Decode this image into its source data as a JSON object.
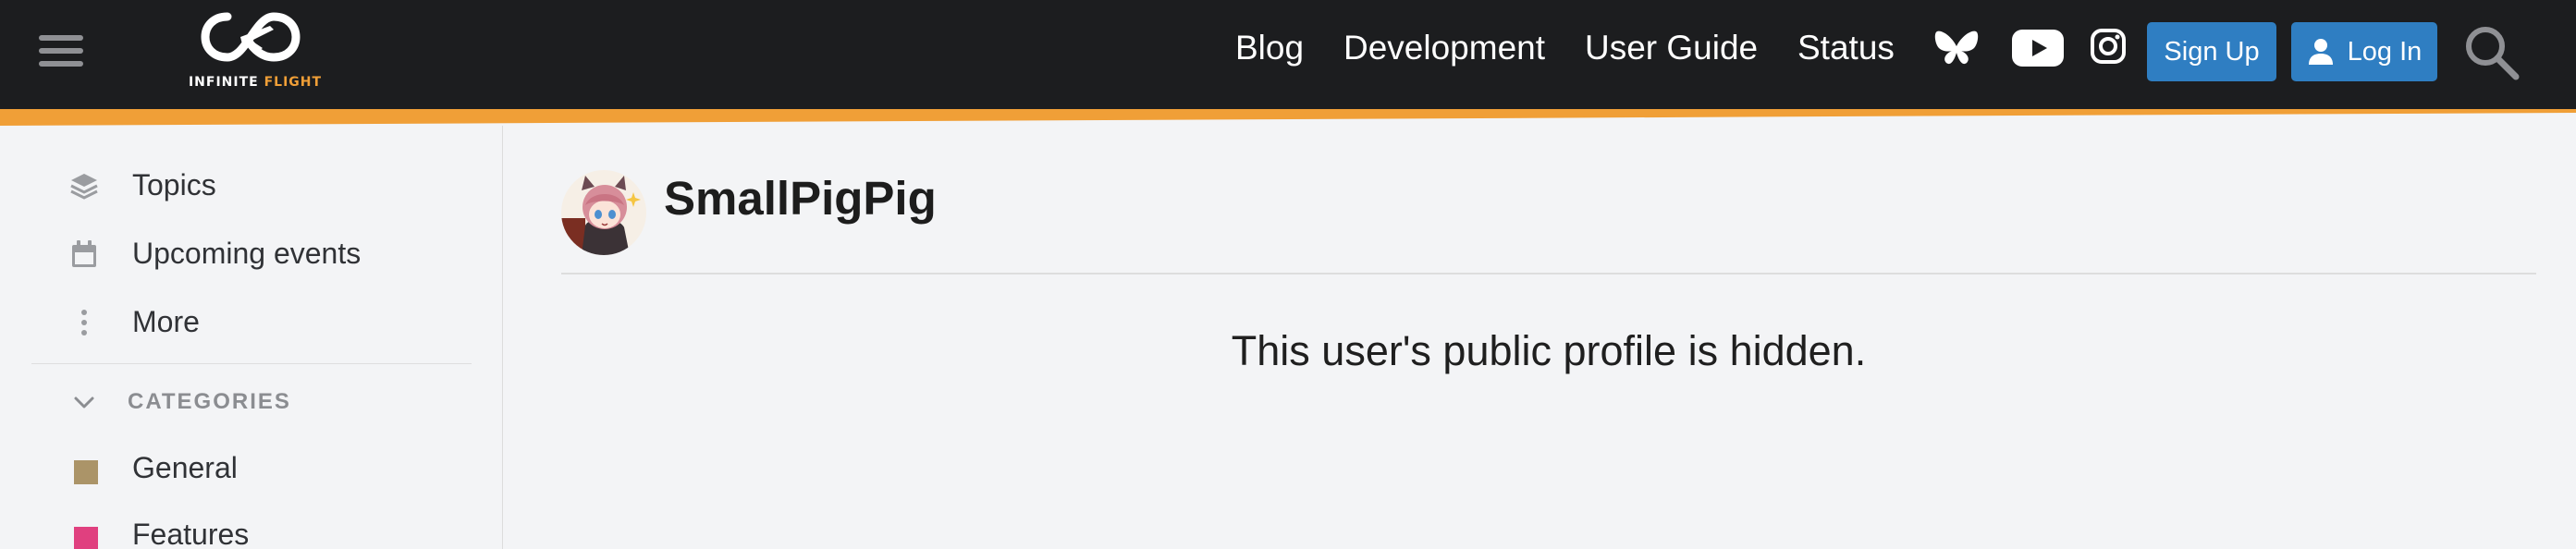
{
  "header": {
    "logo": {
      "word1": "INFINITE",
      "word2": "FLIGHT",
      "icon": "infinite-flight-logo"
    },
    "nav": [
      {
        "label": "Blog"
      },
      {
        "label": "Development"
      },
      {
        "label": "User Guide"
      },
      {
        "label": "Status"
      }
    ],
    "social_icons": [
      "bluesky-icon",
      "youtube-icon",
      "instagram-icon"
    ],
    "signup_label": "Sign Up",
    "login_label": "Log In",
    "colors": {
      "background": "#1c1d1f",
      "stripe": "#f09f37",
      "button": "#2f7ec2"
    }
  },
  "sidebar": {
    "items": [
      {
        "label": "Topics",
        "icon": "layers-icon"
      },
      {
        "label": "Upcoming events",
        "icon": "calendar-icon"
      },
      {
        "label": "More",
        "icon": "vertical-ellipsis-icon"
      }
    ],
    "categories_header": "CATEGORIES",
    "categories": [
      {
        "label": "General",
        "color": "#ab9468"
      },
      {
        "label": "Features",
        "color": "#e0407f"
      }
    ]
  },
  "profile": {
    "username": "SmallPigPig",
    "message": "This user's public profile is hidden."
  }
}
